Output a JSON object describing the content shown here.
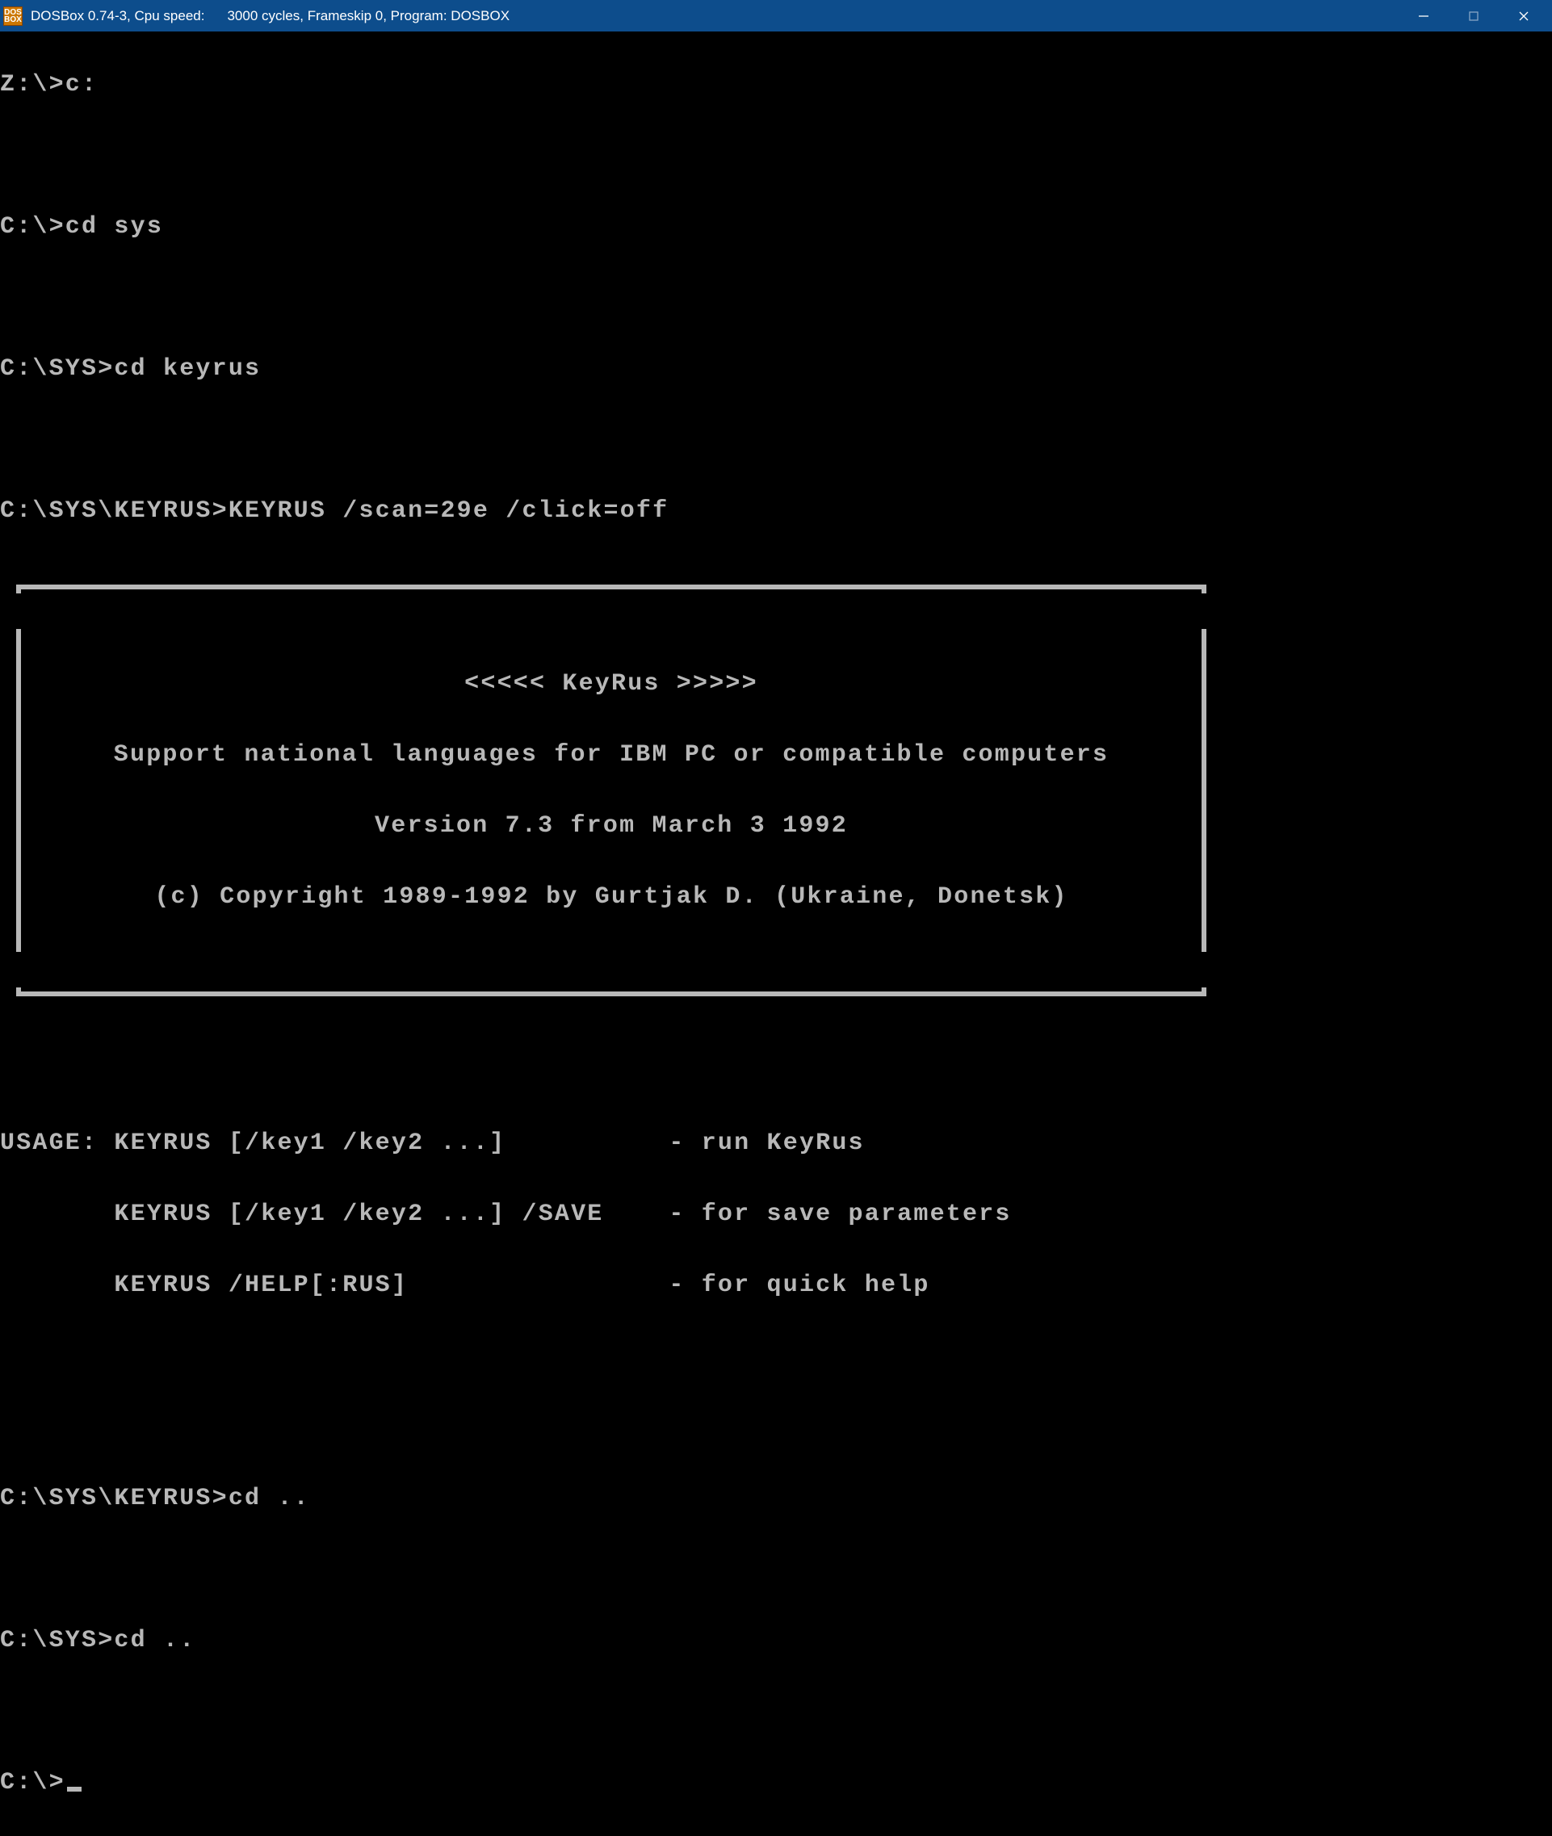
{
  "titlebar": {
    "icon_text": "DOS\nBOX",
    "title_main": "DOSBox 0.74-3, Cpu speed:",
    "title_extra": "3000 cycles, Frameskip  0, Program:    DOSBOX"
  },
  "terminal": {
    "line1": "Z:\\>c:",
    "line2": "C:\\>cd sys",
    "line3": "C:\\SYS>cd keyrus",
    "line4": "C:\\SYS\\KEYRUS>KEYRUS /scan=29e /click=off",
    "box": {
      "l1": "<<<<< KeyRus >>>>>",
      "l2": "Support national languages for IBM PC or compatible computers",
      "l3": "Version 7.3 from March 3 1992",
      "l4": "(c) Copyright 1989-1992 by Gurtjak D. (Ukraine, Donetsk)"
    },
    "usage1": "USAGE: KEYRUS [/key1 /key2 ...]          - run KeyRus",
    "usage2": "       KEYRUS [/key1 /key2 ...] /SAVE    - for save parameters",
    "usage3": "       KEYRUS /HELP[:RUS]                - for quick help",
    "line5": "C:\\SYS\\KEYRUS>cd ..",
    "line6": "C:\\SYS>cd ..",
    "line7": "C:\\>"
  }
}
